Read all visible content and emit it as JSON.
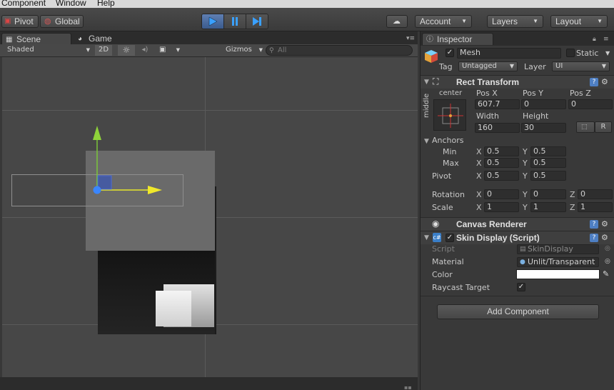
{
  "menu": {
    "items": [
      "Component",
      "Window",
      "Help"
    ]
  },
  "toolbar": {
    "pivot": "Pivot",
    "global": "Global",
    "account": "Account",
    "layers": "Layers",
    "layout": "Layout"
  },
  "scene": {
    "tab_scene": "Scene",
    "tab_game": "Game",
    "shading": "Shaded",
    "mode_2d": "2D",
    "gizmos": "Gizmos",
    "search_placeholder": "All"
  },
  "inspector": {
    "tab": "Inspector",
    "object_name": "Mesh",
    "active": true,
    "static_label": "Static",
    "tag_label": "Tag",
    "tag_value": "Untagged",
    "layer_label": "Layer",
    "layer_value": "UI",
    "rect_transform": {
      "title": "Rect Transform",
      "anchor_h": "center",
      "anchor_v": "middle",
      "posx_label": "Pos X",
      "posy_label": "Pos Y",
      "posz_label": "Pos Z",
      "posx": "607.7",
      "posy": "0",
      "posz": "0",
      "width_label": "Width",
      "height_label": "Height",
      "width": "160",
      "height": "30",
      "r_button": "R",
      "anchors_label": "Anchors",
      "min_label": "Min",
      "max_label": "Max",
      "min_x": "0.5",
      "min_y": "0.5",
      "max_x": "0.5",
      "max_y": "0.5",
      "pivot_label": "Pivot",
      "pivot_x": "0.5",
      "pivot_y": "0.5",
      "rotation_label": "Rotation",
      "rot_x": "0",
      "rot_y": "0",
      "rot_z": "0",
      "scale_label": "Scale",
      "scale_x": "1",
      "scale_y": "1",
      "scale_z": "1",
      "x": "X",
      "y": "Y",
      "z": "Z"
    },
    "canvas_renderer": {
      "title": "Canvas Renderer"
    },
    "skin_display": {
      "title": "Skin Display (Script)",
      "enabled": true,
      "script_label": "Script",
      "script_value": "SkinDisplay",
      "material_label": "Material",
      "material_value": "Unlit/Transparent",
      "color_label": "Color",
      "color_value": "#ffffff",
      "raycast_label": "Raycast Target",
      "raycast": true
    },
    "add_component": "Add Component"
  },
  "colors": {
    "accent_play": "#4a78c0",
    "gizmo_x": "#e8e82a",
    "gizmo_y": "#7ac43a",
    "gizmo_center": "#3a86ff"
  }
}
